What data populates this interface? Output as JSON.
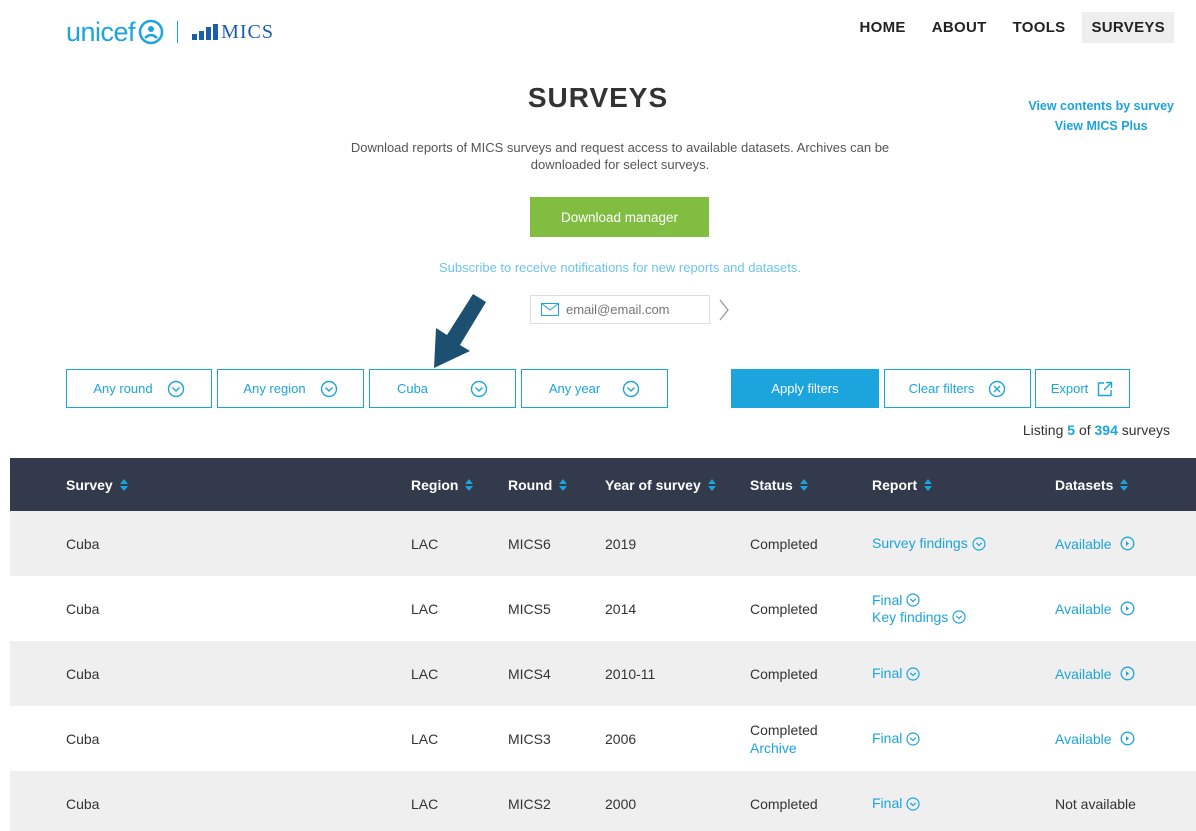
{
  "header": {
    "logo_text": "unicef",
    "logo_product": "MICS",
    "nav": [
      {
        "label": "HOME",
        "active": false
      },
      {
        "label": "ABOUT",
        "active": false
      },
      {
        "label": "TOOLS",
        "active": false
      },
      {
        "label": "SURVEYS",
        "active": true
      }
    ]
  },
  "side_links": [
    "View contents by survey",
    "View MICS Plus"
  ],
  "page": {
    "title": "SURVEYS",
    "intro": "Download reports of MICS surveys and request access to available datasets. Archives can be downloaded for select surveys.",
    "download_button": "Download manager",
    "subscribe_text": "Subscribe to receive notifications for new reports and datasets.",
    "email_placeholder": "email@email.com"
  },
  "filters": {
    "round": "Any round",
    "region": "Any region",
    "country": "Cuba",
    "year": "Any year",
    "apply": "Apply filters",
    "clear": "Clear filters",
    "export": "Export"
  },
  "listing": {
    "prefix": "Listing",
    "shown": "5",
    "of": "of",
    "total": "394",
    "suffix": "surveys"
  },
  "table": {
    "columns": [
      "Survey",
      "Region",
      "Round",
      "Year of survey",
      "Status",
      "Report",
      "Datasets"
    ],
    "rows": [
      {
        "survey": "Cuba",
        "region": "LAC",
        "round": "MICS6",
        "year": "2019",
        "status": "Completed",
        "archive": "",
        "reports": [
          "Survey findings"
        ],
        "datasets": "Available",
        "datasets_available": true
      },
      {
        "survey": "Cuba",
        "region": "LAC",
        "round": "MICS5",
        "year": "2014",
        "status": "Completed",
        "archive": "",
        "reports": [
          "Final",
          "Key findings"
        ],
        "datasets": "Available",
        "datasets_available": true
      },
      {
        "survey": "Cuba",
        "region": "LAC",
        "round": "MICS4",
        "year": "2010-11",
        "status": "Completed",
        "archive": "",
        "reports": [
          "Final"
        ],
        "datasets": "Available",
        "datasets_available": true
      },
      {
        "survey": "Cuba",
        "region": "LAC",
        "round": "MICS3",
        "year": "2006",
        "status": "Completed",
        "archive": "Archive",
        "reports": [
          "Final"
        ],
        "datasets": "Available",
        "datasets_available": true
      },
      {
        "survey": "Cuba",
        "region": "LAC",
        "round": "MICS2",
        "year": "2000",
        "status": "Completed",
        "archive": "",
        "reports": [
          "Final"
        ],
        "datasets": "Not available",
        "datasets_available": false
      }
    ]
  },
  "colors": {
    "accent": "#1ca4dc",
    "green": "#80bd41",
    "table_header": "#323a4b",
    "arrow": "#1d4f70"
  }
}
